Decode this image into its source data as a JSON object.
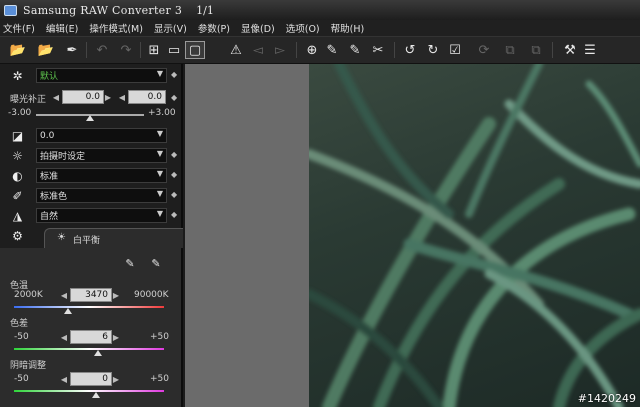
{
  "window": {
    "title": "Samsung RAW Converter 3",
    "page": "1/1"
  },
  "menu": [
    "文件(F)",
    "编辑(E)",
    "操作模式(M)",
    "显示(V)",
    "参数(P)",
    "显像(D)",
    "选项(O)",
    "帮助(H)"
  ],
  "panel": {
    "preset": {
      "value": "默认"
    },
    "exposure": {
      "label": "曝光补正",
      "value": "0.0",
      "value2": "0.0",
      "min": "-3.00",
      "max": "+3.00",
      "level": 0
    },
    "contrast": {
      "value": "0.0"
    },
    "white_balance_mode": {
      "value": "拍摄时设定"
    },
    "tone": {
      "value": "标准"
    },
    "color": {
      "value": "标准色"
    },
    "sharpness": {
      "value": "自然"
    },
    "wb_tab": {
      "label": "白平衡"
    },
    "temperature": {
      "label": "色温",
      "min": "2000K",
      "max": "90000K",
      "value": "3470"
    },
    "tint": {
      "label": "色差",
      "min": "-50",
      "max": "+50",
      "value": "6"
    },
    "shadow": {
      "label": "阴暗调整",
      "min": "-50",
      "max": "+50",
      "value": "0"
    }
  },
  "watermark": "#1420249",
  "colors": {
    "accent_green": "#5cc04c",
    "canvas_gray": "#6b6b6b"
  },
  "icons": [
    "open-folder-icon",
    "open-folder-menu-icon",
    "stamp-icon",
    "undo-icon",
    "redo-icon",
    "grid-view-icon",
    "compare-view-icon",
    "single-view-icon",
    "warning-icon",
    "prev-icon",
    "next-icon",
    "crop-grid-icon",
    "wb-picker-icon",
    "wb-picker2-icon",
    "spot-icon",
    "rotate-left-icon",
    "rotate-right-icon",
    "check-icon",
    "refresh-icon",
    "copy-settings-icon",
    "paste-settings-icon",
    "hammer-icon",
    "edit-list-icon"
  ]
}
